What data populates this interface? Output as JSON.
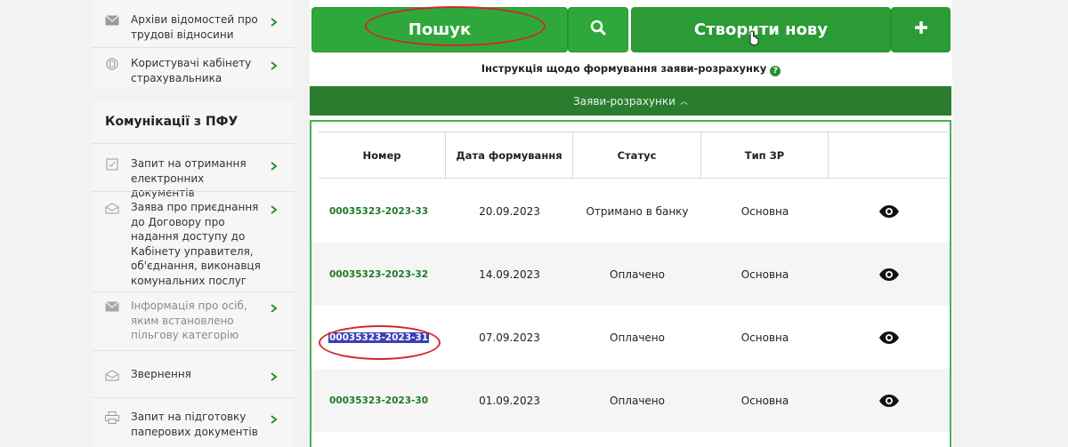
{
  "sidebar": {
    "top_items": [
      {
        "label": "Архіви відомостей про трудові відносини",
        "icon": "envelope-icon"
      },
      {
        "label": "Користувачі кабінету страхувальника",
        "icon": "document-circle-icon"
      }
    ],
    "comm_title": "Комунікації з ПФУ",
    "comm_items": [
      {
        "label": "Запит на отримання електронних документів",
        "icon": "document-check-icon",
        "muted": false
      },
      {
        "label": "Заява про приєднання до Договору про надання доступу до Кабінету управителя, об'єднання, виконавця комунальних послуг",
        "icon": "envelope-open-icon",
        "muted": false
      },
      {
        "label": "Інформація про осіб, яким встановлено пільгову категорію",
        "icon": "envelope-icon",
        "muted": true
      },
      {
        "label": "Звернення",
        "icon": "envelope-open-icon",
        "muted": false
      },
      {
        "label": "Запит на підготовку паперових документів",
        "icon": "printer-icon",
        "muted": false
      }
    ]
  },
  "main": {
    "search_label": "Пошук",
    "create_label": "Створити нову",
    "instruction": "Інструкція щодо формування заяви-розрахунку",
    "section_title": "Заяви-розрахунки",
    "columns": [
      "Номер",
      "Дата формування",
      "Статус",
      "Тип ЗР",
      ""
    ],
    "rows": [
      {
        "number": "00035323-2023-33",
        "date": "20.09.2023",
        "status": "Отримано в банку",
        "type": "Основна"
      },
      {
        "number": "00035323-2023-32",
        "date": "14.09.2023",
        "status": "Оплачено",
        "type": "Основна"
      },
      {
        "number": "00035323-2023-31",
        "date": "07.09.2023",
        "status": "Оплачено",
        "type": "Основна"
      },
      {
        "number": "00035323-2023-30",
        "date": "01.09.2023",
        "status": "Оплачено",
        "type": "Основна"
      }
    ]
  },
  "colors": {
    "green": "#2ea83a",
    "dark_green": "#2a7d2e",
    "highlight": "#d2262b"
  }
}
